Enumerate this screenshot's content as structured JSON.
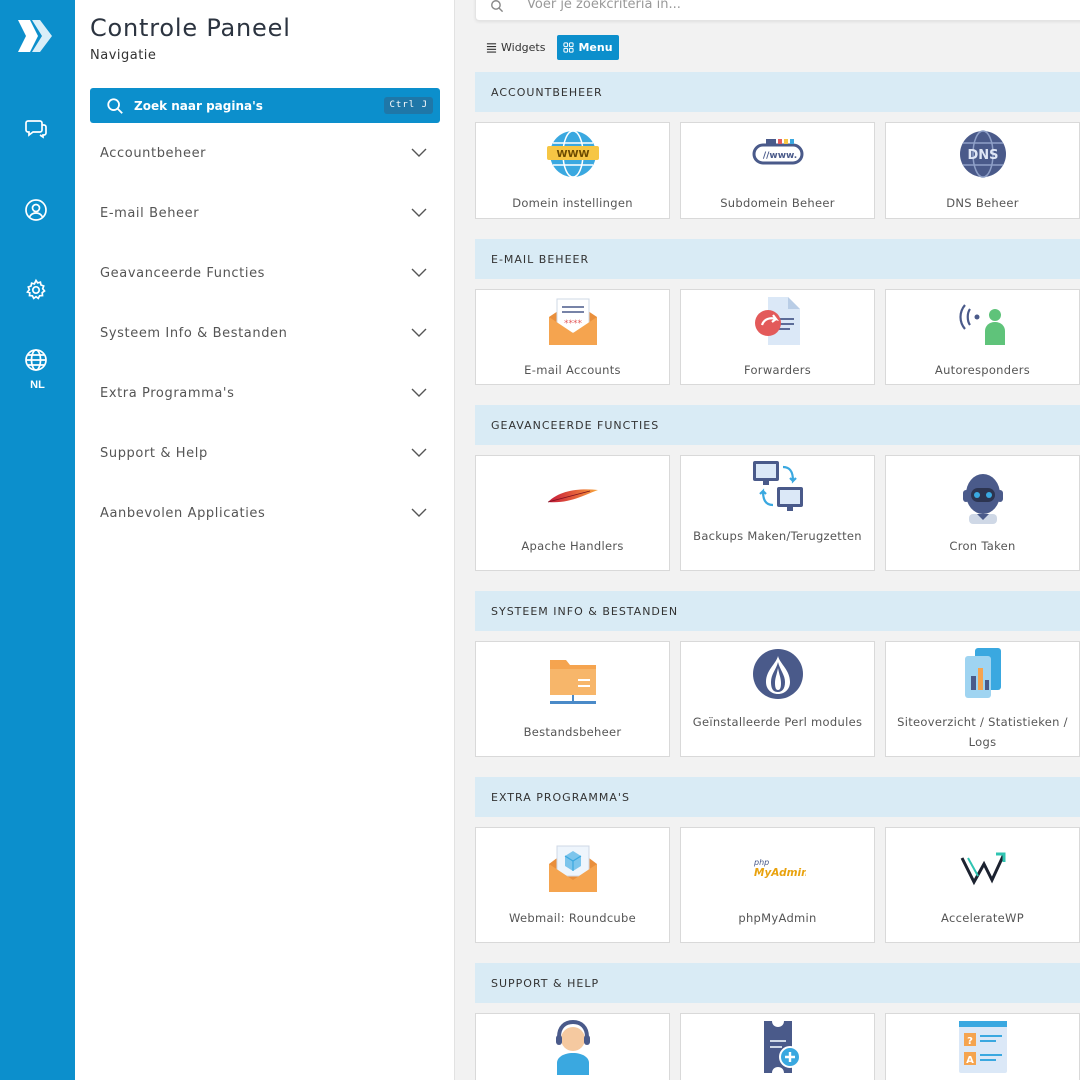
{
  "rail": {
    "language": "NL"
  },
  "nav": {
    "title": "Controle Paneel",
    "subtitle": "Navigatie",
    "search_label": "Zoek naar pagina's",
    "search_shortcut": "Ctrl J",
    "items": [
      {
        "label": "Accountbeheer"
      },
      {
        "label": "E-mail Beheer"
      },
      {
        "label": "Geavanceerde Functies"
      },
      {
        "label": "Systeem Info & Bestanden"
      },
      {
        "label": "Extra Programma's"
      },
      {
        "label": "Support & Help"
      },
      {
        "label": "Aanbevolen Applicaties"
      }
    ]
  },
  "main": {
    "search_placeholder": "Voer je zoekcriteria in...",
    "view_widgets": "Widgets",
    "view_menu": "Menu",
    "sections": [
      {
        "title": "ACCOUNTBEHEER",
        "tiles": [
          {
            "label": "Domein instellingen",
            "icon": "www-globe-icon"
          },
          {
            "label": "Subdomein Beheer",
            "icon": "subdomain-icon"
          },
          {
            "label": "DNS Beheer",
            "icon": "dns-icon"
          }
        ]
      },
      {
        "title": "E-MAIL BEHEER",
        "tiles": [
          {
            "label": "E-mail Accounts",
            "icon": "email-envelope-icon"
          },
          {
            "label": "Forwarders",
            "icon": "forward-document-icon"
          },
          {
            "label": "Autoresponders",
            "icon": "autoresponder-icon"
          }
        ]
      },
      {
        "title": "GEAVANCEERDE FUNCTIES",
        "tiles": [
          {
            "label": "Apache Handlers",
            "icon": "apache-feather-icon"
          },
          {
            "label": "Backups Maken/Terugzetten",
            "icon": "backup-computers-icon"
          },
          {
            "label": "Cron Taken",
            "icon": "robot-icon"
          }
        ]
      },
      {
        "title": "SYSTEEM INFO & BESTANDEN",
        "tiles": [
          {
            "label": "Bestandsbeheer",
            "icon": "folder-icon"
          },
          {
            "label": "Geïnstalleerde Perl modules",
            "icon": "perl-onion-icon"
          },
          {
            "label": "Siteoverzicht / Statistieken / Logs",
            "icon": "statistics-icon"
          }
        ]
      },
      {
        "title": "EXTRA PROGRAMMA'S",
        "tiles": [
          {
            "label": "Webmail: Roundcube",
            "icon": "webmail-icon"
          },
          {
            "label": "phpMyAdmin",
            "icon": "phpmyadmin-icon",
            "icon_text_top": "php",
            "icon_text_bottom": "MyAdmin"
          },
          {
            "label": "AccelerateWP",
            "icon": "acceleratewp-icon"
          }
        ]
      },
      {
        "title": "SUPPORT & HELP",
        "tiles": [
          {
            "label": "",
            "icon": "support-agent-icon"
          },
          {
            "label": "",
            "icon": "ticket-icon"
          },
          {
            "label": "",
            "icon": "faq-document-icon"
          }
        ]
      }
    ]
  }
}
